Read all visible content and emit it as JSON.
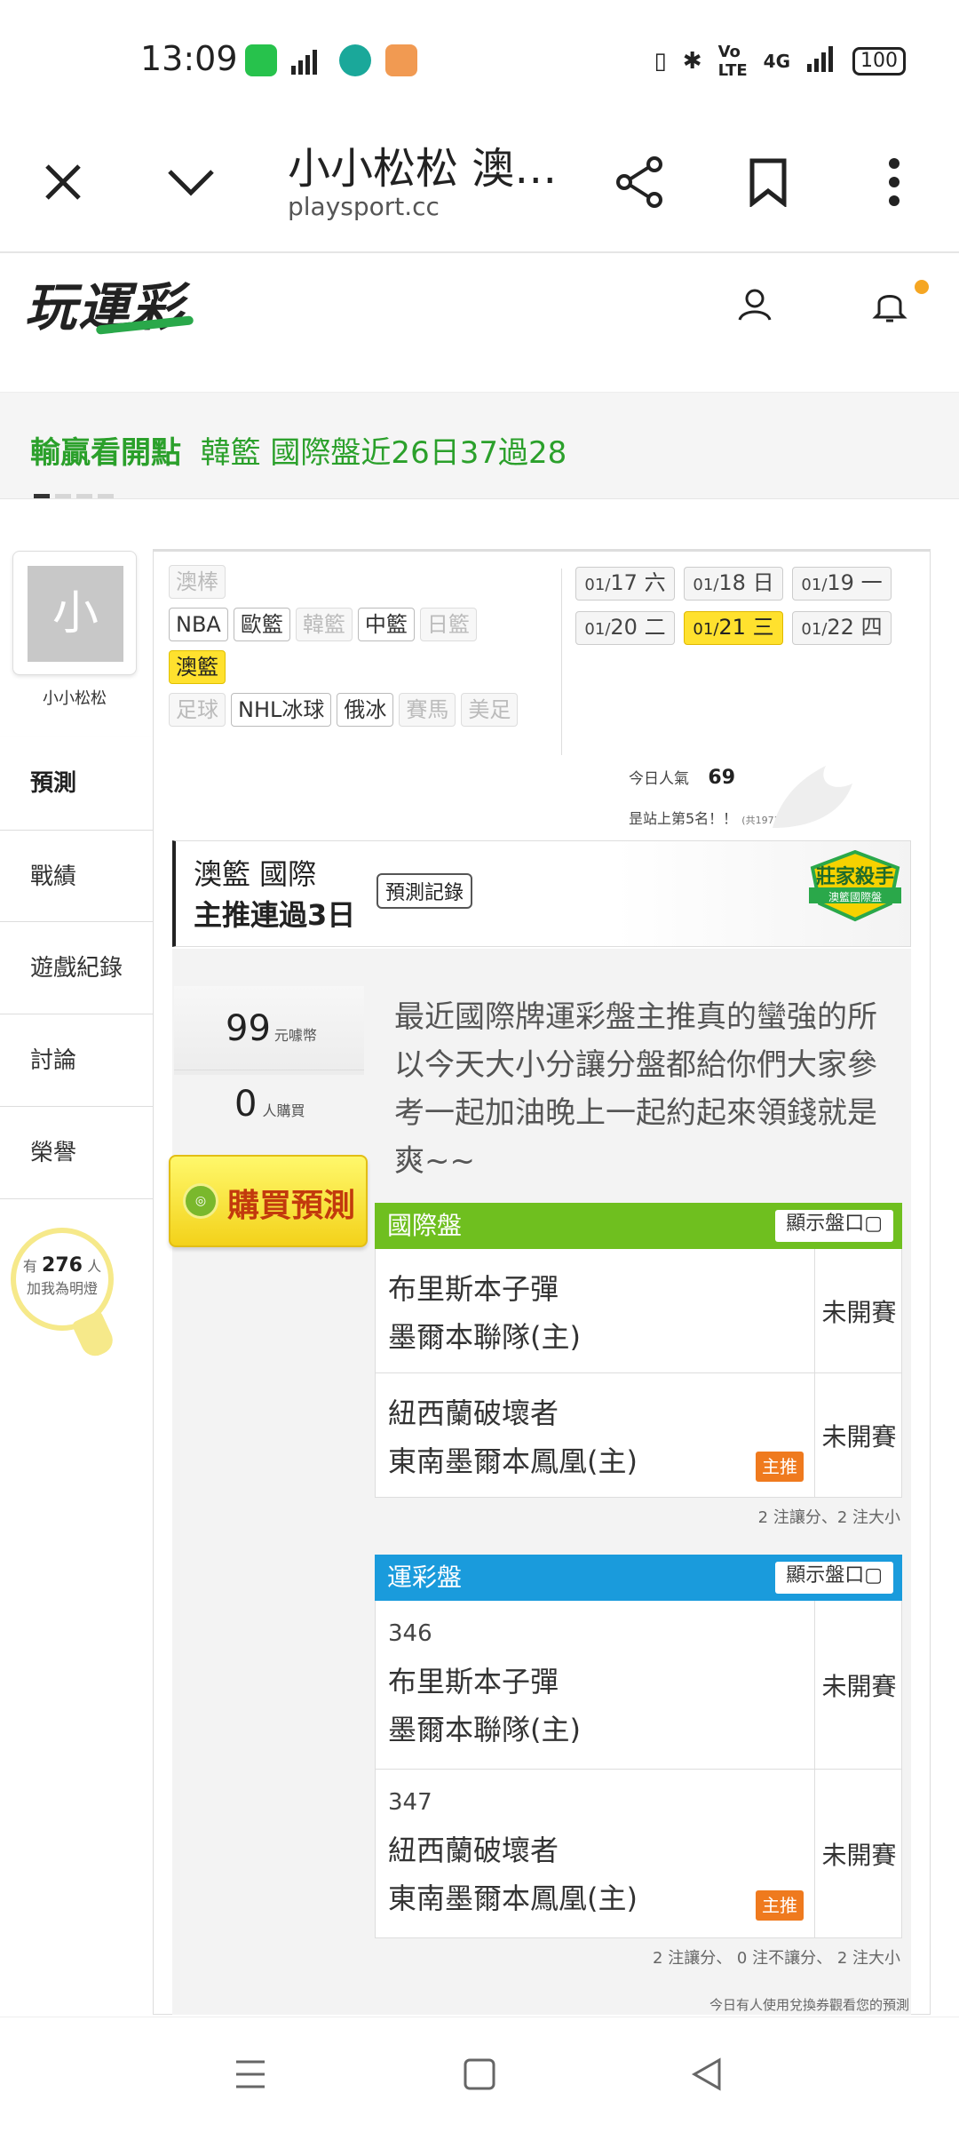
{
  "status_bar": {
    "time": "13:09",
    "battery": "100",
    "network": "4G"
  },
  "browser": {
    "title": "小小松松 澳…",
    "url": "playsport.cc"
  },
  "site": {
    "logo": "玩運彩"
  },
  "banner": {
    "bold": "輸贏看開點",
    "rest": "韓籃 國際盤近26日37過28"
  },
  "profile": {
    "avatar_char": "小",
    "name": "小小松松"
  },
  "left_nav": [
    {
      "label": "預測"
    },
    {
      "label": "戰績"
    },
    {
      "label": "遊戲紀錄"
    },
    {
      "label": "討論"
    },
    {
      "label": "榮譽"
    }
  ],
  "fans": {
    "prefix": "有",
    "count": "276",
    "unit": "人",
    "caption": "加我為明燈"
  },
  "sports": [
    {
      "label": "澳棒",
      "state": "disabled"
    },
    {
      "label": "NBA",
      "state": "normal"
    },
    {
      "label": "歐籃",
      "state": "normal"
    },
    {
      "label": "韓籃",
      "state": "disabled"
    },
    {
      "label": "中籃",
      "state": "normal"
    },
    {
      "label": "日籃",
      "state": "disabled"
    },
    {
      "label": "澳籃",
      "state": "selected"
    },
    {
      "label": "足球",
      "state": "disabled"
    },
    {
      "label": "NHL冰球",
      "state": "normal"
    },
    {
      "label": "俄冰",
      "state": "normal"
    },
    {
      "label": "賽馬",
      "state": "disabled"
    },
    {
      "label": "美足",
      "state": "disabled"
    }
  ],
  "dates": [
    {
      "md": "01/",
      "d": "17",
      "w": "六",
      "selected": false
    },
    {
      "md": "01/",
      "d": "18",
      "w": "日",
      "selected": false
    },
    {
      "md": "01/",
      "d": "19",
      "w": "一",
      "selected": false
    },
    {
      "md": "01/",
      "d": "20",
      "w": "二",
      "selected": false
    },
    {
      "md": "01/",
      "d": "21",
      "w": "三",
      "selected": true
    },
    {
      "md": "01/",
      "d": "22",
      "w": "四",
      "selected": false
    }
  ],
  "popularity": {
    "label": "今日人氣",
    "value": "69",
    "rank_text": "昰站上第5名！！",
    "rank_note": "(共1973人)"
  },
  "section": {
    "line1": "澳籃 國際",
    "line2": "主推連過3日",
    "record_button": "預測記錄",
    "badge_title": "莊家殺手",
    "badge_sub": "澳籃國際盤"
  },
  "purchase": {
    "price": "99",
    "price_unit": "元噱幣",
    "buyers": "0",
    "buyers_unit": "人購買",
    "buy_button": "購買預測"
  },
  "description": "最近國際牌運彩盤主推真的蠻強的所以今天大小分讓分盤都給你們大家參考一起加油晚上一起約起來領錢就是爽~~",
  "intl_table": {
    "title": "國際盤",
    "show_button": "顯示盤口",
    "color": "#6fbf1f",
    "rows": [
      {
        "team1": "布里斯本子彈",
        "team2": "墨爾本聯隊(主)",
        "status": "未開賽",
        "tag": ""
      },
      {
        "team1": "紐西蘭破壞者",
        "team2": "東南墨爾本鳳凰(主)",
        "status": "未開賽",
        "tag": "主推"
      }
    ],
    "note": "2 注讓分、2 注大小"
  },
  "lottery_table": {
    "title": "運彩盤",
    "show_button": "顯示盤口",
    "color": "#1a9bdc",
    "rows": [
      {
        "num": "346",
        "team1": "布里斯本子彈",
        "team2": "墨爾本聯隊(主)",
        "status": "未開賽",
        "tag": ""
      },
      {
        "num": "347",
        "team1": "紐西蘭破壞者",
        "team2": "東南墨爾本鳳凰(主)",
        "status": "未開賽",
        "tag": "主推"
      }
    ],
    "note": "2 注讓分、 0 注不讓分、 2 注大小"
  },
  "footer_note": "今日有人使用兌換券觀看您的預測"
}
